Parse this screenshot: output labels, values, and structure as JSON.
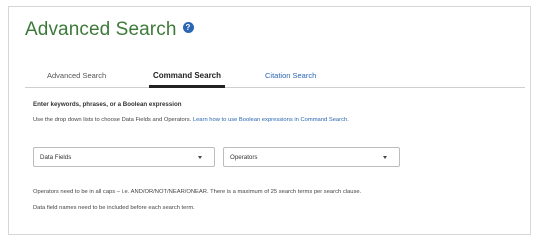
{
  "page": {
    "title": "Advanced Search",
    "help_icon": "question-circle-icon"
  },
  "tabs": [
    {
      "label": "Advanced Search",
      "active": false
    },
    {
      "label": "Command Search",
      "active": true
    },
    {
      "label": "Citation Search",
      "active": false
    }
  ],
  "form": {
    "prompt_label": "Enter keywords, phrases, or a Boolean expression",
    "instructions": "Use the drop down lists to choose Data Fields and Operators.",
    "instructions_link": "Learn how to use Boolean expressions in Command Search.",
    "data_fields_select": "Data Fields",
    "operators_select": "Operators"
  },
  "notes": {
    "line1": "Operators need to be in all caps – i.e. AND/OR/NOT/NEAR/ONEAR. There is a maximum of 25 search terms per search clause.",
    "line2": "Data field names need to be included before each search term."
  },
  "colors": {
    "title": "#3d7a3a",
    "link": "#2a66b3",
    "help_icon_bg": "#2a66b3"
  }
}
